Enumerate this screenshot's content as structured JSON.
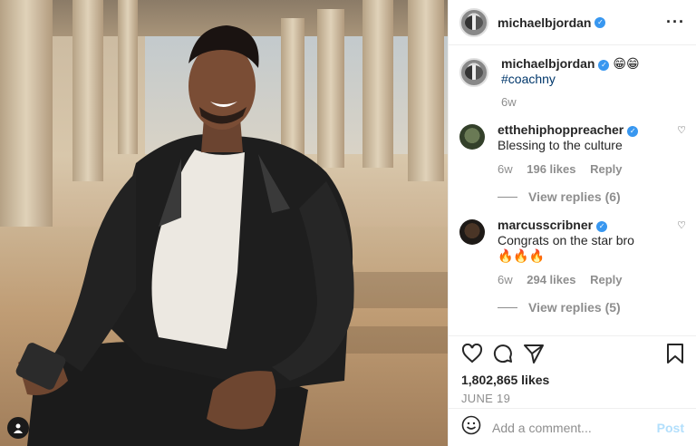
{
  "post": {
    "author": "michaelbjordan",
    "caption": {
      "author": "michaelbjordan",
      "emojis": "😁😁",
      "hashtag": "#coachny",
      "age": "6w"
    },
    "comments": [
      {
        "author": "etthehiphoppreacher",
        "text": "Blessing to the culture",
        "age": "6w",
        "likes": "196 likes",
        "reply": "Reply",
        "view_replies": "View replies (6)"
      },
      {
        "author": "marcusscribner",
        "text": "Congrats on the star bro",
        "emojis": "🔥🔥🔥",
        "age": "6w",
        "likes": "294 likes",
        "reply": "Reply",
        "view_replies": "View replies (5)"
      }
    ],
    "likes_count": "1,802,865 likes",
    "date": "JUNE 19",
    "add_comment_placeholder": "Add a comment...",
    "post_label": "Post",
    "more_label": "···"
  },
  "icons": {
    "like": "heart-icon",
    "comment": "comment-icon",
    "share": "share-icon",
    "save": "bookmark-icon",
    "emoji": "emoji-icon",
    "tag": "user-tag-icon"
  },
  "colors": {
    "verified": "#3897f0",
    "hashtag": "#00376b",
    "muted": "#8e8e8e",
    "post_disabled": "#b2dffc"
  }
}
